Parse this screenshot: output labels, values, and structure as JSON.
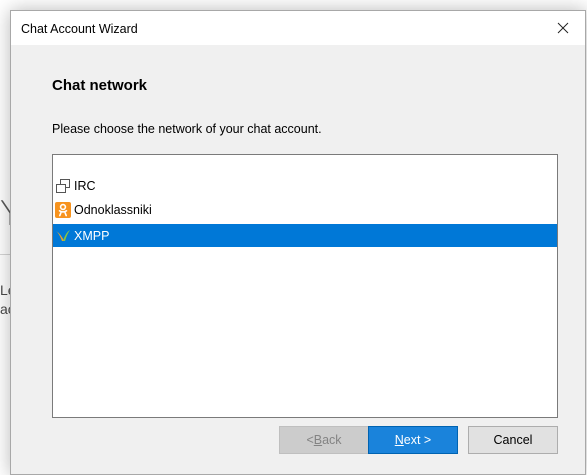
{
  "background": {
    "big_letter": "Y",
    "line1": "Le",
    "line2": "ac"
  },
  "dialog": {
    "title": "Chat Account Wizard",
    "heading": "Chat network",
    "description": "Please choose the network of your chat account."
  },
  "networks": [
    {
      "label": "IRC",
      "icon": "irc-icon",
      "selected": false
    },
    {
      "label": "Odnoklassniki",
      "icon": "odnoklassniki-icon",
      "selected": false
    },
    {
      "label": "XMPP",
      "icon": "xmpp-icon",
      "selected": true
    }
  ],
  "buttons": {
    "back": {
      "prefix": "< ",
      "mnemonic": "B",
      "rest": "ack",
      "enabled": false
    },
    "next": {
      "mnemonic": "N",
      "rest": "ext >",
      "enabled": true
    },
    "cancel": "Cancel"
  },
  "colors": {
    "selection": "#0078d7",
    "primary_button": "#1a83db",
    "dialog_bg": "#f0f0f0",
    "odnoklassniki_orange": "#f7931e",
    "xmpp_green": "#8cc63f",
    "xmpp_orange": "#e8a22b"
  }
}
